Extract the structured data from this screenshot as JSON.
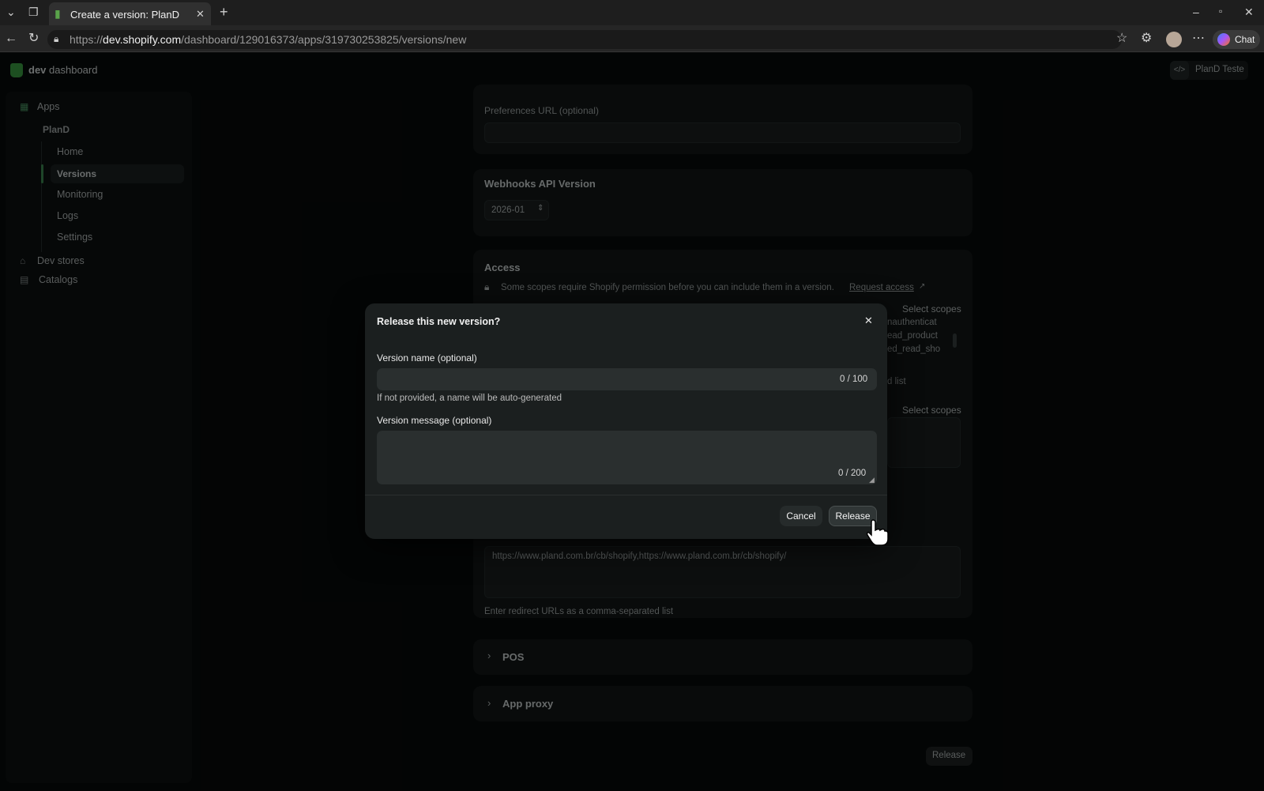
{
  "browser": {
    "tab_title": "Create a version: PlanD",
    "url_scheme": "https://",
    "url_host": "dev.shopify.com",
    "url_path": "/dashboard/129016373/apps/319730253825/versions/new",
    "chat_label": "Chat"
  },
  "header": {
    "brand_bold": "dev",
    "brand_rest": " dashboard",
    "app_chip": "PlanD Teste"
  },
  "sidebar": {
    "apps": "Apps",
    "app_name": "PlanD",
    "items": [
      "Home",
      "Versions",
      "Monitoring",
      "Logs",
      "Settings"
    ],
    "active": "Versions",
    "dev_stores": "Dev stores",
    "catalogs": "Catalogs"
  },
  "main": {
    "preferences_label": "Preferences URL (optional)",
    "webhooks_title": "Webhooks API Version",
    "webhooks_value": "2026-01",
    "access_title": "Access",
    "access_notice": "Some scopes require Shopify permission before you can include them in a version.",
    "request_access": "Request access",
    "select_scopes_1": "Select scopes",
    "scopes": [
      "nauthenticat",
      "ead_product",
      "ed_read_sho"
    ],
    "list_suffix": "d list",
    "select_scopes_2": "Select scopes",
    "redirect_urls_value": "https://www.pland.com.br/cb/shopify,https://www.pland.com.br/cb/shopify/",
    "redirect_help": "Enter redirect URLs as a comma-separated list",
    "pos_title": "POS",
    "app_proxy_title": "App proxy",
    "release_button": "Release"
  },
  "modal": {
    "title": "Release this new version?",
    "name_label": "Version name (optional)",
    "name_value": "",
    "name_count": "0 / 100",
    "name_help": "If not provided, a name will be auto-generated",
    "message_label": "Version message (optional)",
    "message_value": "",
    "message_count": "0 / 200",
    "cancel": "Cancel",
    "release": "Release"
  }
}
